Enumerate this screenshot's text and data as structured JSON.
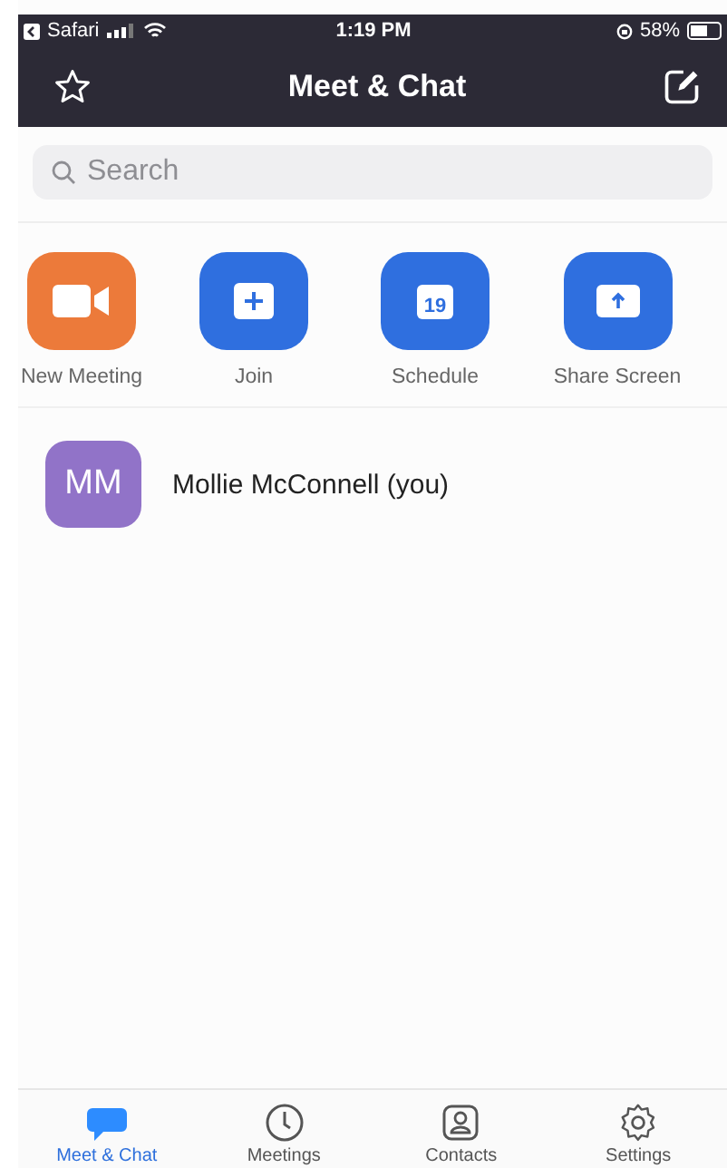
{
  "status_bar": {
    "back_app": "Safari",
    "time": "1:19 PM",
    "battery": "58%"
  },
  "header": {
    "title": "Meet & Chat"
  },
  "search": {
    "placeholder": "Search"
  },
  "actions": [
    {
      "kind": "video",
      "label": "New Meeting",
      "color": "#ec7a3a"
    },
    {
      "kind": "plus",
      "label": "Join",
      "color": "#2f6fdf"
    },
    {
      "kind": "calendar",
      "label": "Schedule",
      "color": "#2f6fdf",
      "date": "19"
    },
    {
      "kind": "share",
      "label": "Share Screen",
      "color": "#2f6fdf"
    }
  ],
  "contacts": [
    {
      "initials": "MM",
      "name": "Mollie McConnell (you)",
      "color": "#9173c8"
    }
  ],
  "tabs": [
    {
      "kind": "chat",
      "label": "Meet & Chat",
      "selected": true
    },
    {
      "kind": "clock",
      "label": "Meetings",
      "selected": false
    },
    {
      "kind": "contact",
      "label": "Contacts",
      "selected": false
    },
    {
      "kind": "gear",
      "label": "Settings",
      "selected": false
    }
  ]
}
